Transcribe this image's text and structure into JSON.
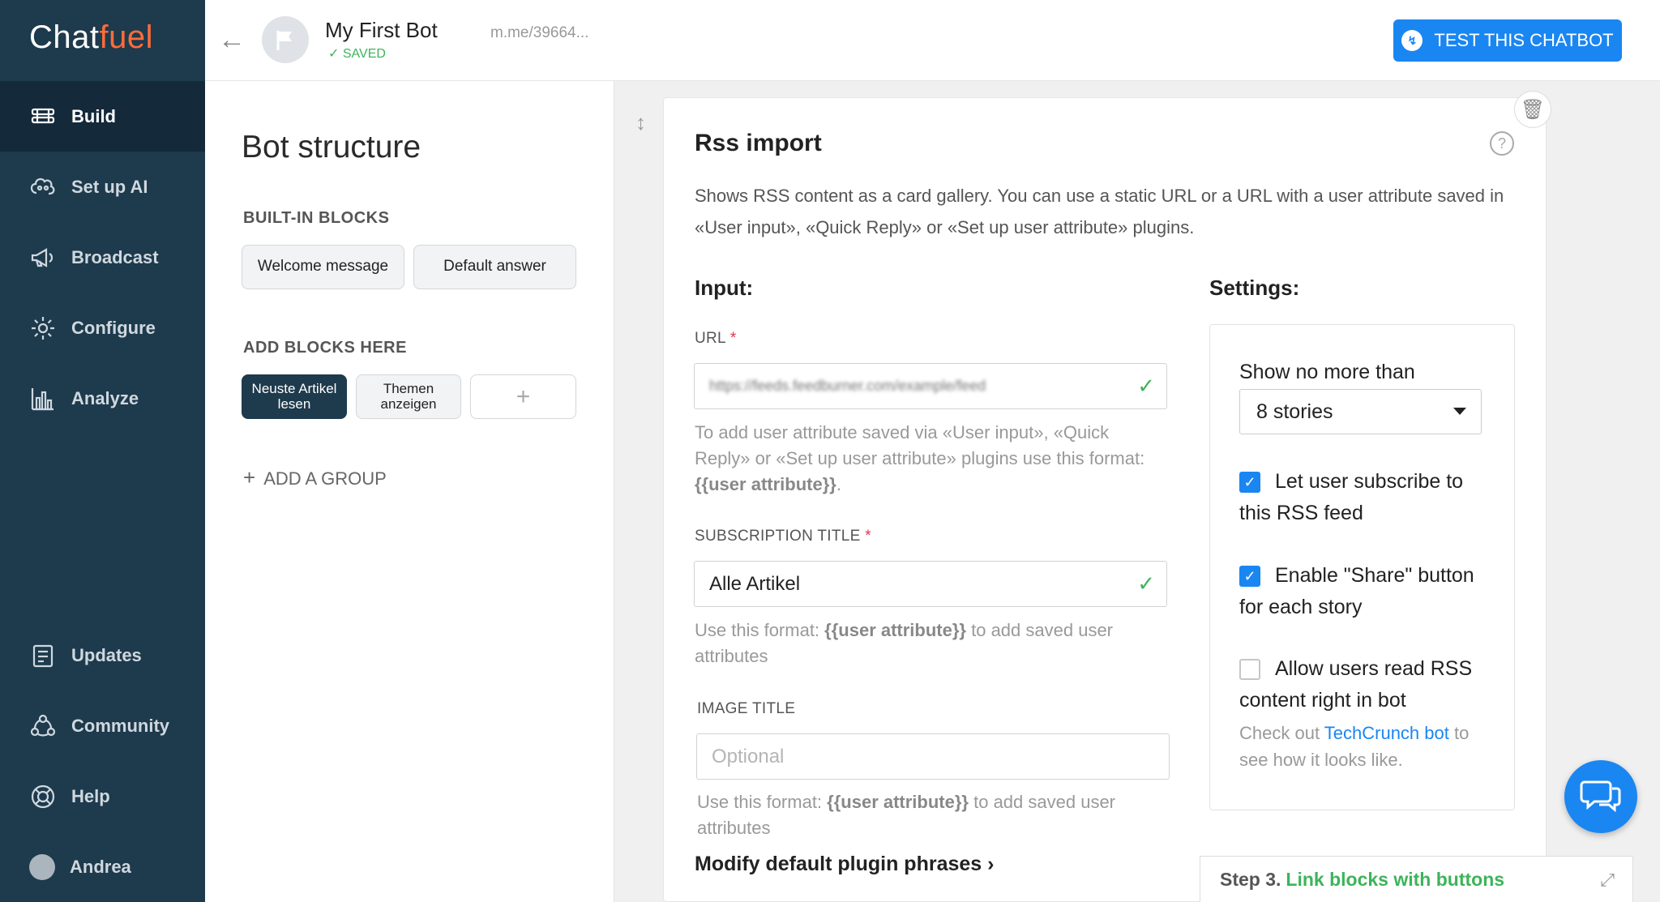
{
  "app": {
    "logo_main": "Chat",
    "logo_accent": "fuel"
  },
  "sidebar": {
    "items": [
      {
        "label": "Build",
        "icon": "build-icon",
        "active": true
      },
      {
        "label": "Set up AI",
        "icon": "brain-icon"
      },
      {
        "label": "Broadcast",
        "icon": "megaphone-icon"
      },
      {
        "label": "Configure",
        "icon": "gear-icon"
      },
      {
        "label": "Analyze",
        "icon": "bar-chart-icon"
      },
      {
        "label": "Updates",
        "icon": "updates-icon"
      },
      {
        "label": "Community",
        "icon": "community-icon"
      },
      {
        "label": "Help",
        "icon": "lifebuoy-icon"
      },
      {
        "label": "Andrea",
        "icon": "user-avatar"
      }
    ]
  },
  "header": {
    "bot_name": "My First Bot",
    "saved_label": "SAVED",
    "bot_link": "m.me/39664...",
    "test_button": "TEST THIS CHATBOT"
  },
  "structure": {
    "title": "Bot structure",
    "built_in_label": "BUILT-IN BLOCKS",
    "built_in_blocks": [
      "Welcome message",
      "Default answer"
    ],
    "add_blocks_label": "ADD BLOCKS HERE",
    "blocks": [
      "Neuste Artikel lesen",
      "Themen anzeigen"
    ],
    "add_block": "+",
    "add_group": "ADD A GROUP"
  },
  "plugin": {
    "title": "Rss import",
    "description": "Shows RSS content as a card gallery. You can use a static URL or a URL with a user attribute saved in «User input», «Quick Reply» or «Set up user attribute» plugins.",
    "input_heading": "Input:",
    "settings_heading": "Settings:",
    "url_label": "URL",
    "required_mark": "*",
    "url_value": "https://feeds.feedburner.com/example/feed",
    "url_hint_prefix": "To add user attribute saved via «User input», «Quick Reply» or «Set up user attribute» plugins use this format: ",
    "url_hint_code": "{{user attribute}}",
    "url_hint_suffix": ".",
    "subscription_label": "SUBSCRIPTION TITLE",
    "subscription_value": "Alle Artikel",
    "subscription_hint_prefix": "Use this format: ",
    "subscription_hint_code": "{{user attribute}}",
    "subscription_hint_suffix": " to add saved user attributes",
    "image_label": "IMAGE TITLE",
    "image_placeholder": "Optional",
    "image_hint_prefix": "Use this format: ",
    "image_hint_code": "{{user attribute}}",
    "image_hint_suffix": " to add saved user attributes",
    "modify_link": "Modify default plugin phrases ›"
  },
  "settings": {
    "limit_label": "Show no more than",
    "limit_value": "8 stories",
    "subscribe_label": "Let user subscribe to this RSS feed",
    "subscribe_checked": true,
    "share_label": "Enable \"Share\" button for each story",
    "share_checked": true,
    "read_label": "Allow users read RSS content right in bot",
    "read_checked": false,
    "note_prefix": "Check out ",
    "note_link": "TechCrunch bot",
    "note_suffix": " to see how it looks like."
  },
  "step_bar": {
    "prefix": "Step 3.",
    "link": "Link blocks with buttons"
  },
  "colors": {
    "sidebar": "#1e3a4d",
    "accent_blue": "#1a86f2",
    "success_green": "#3db45a",
    "logo_accent": "#ff6c3a"
  }
}
